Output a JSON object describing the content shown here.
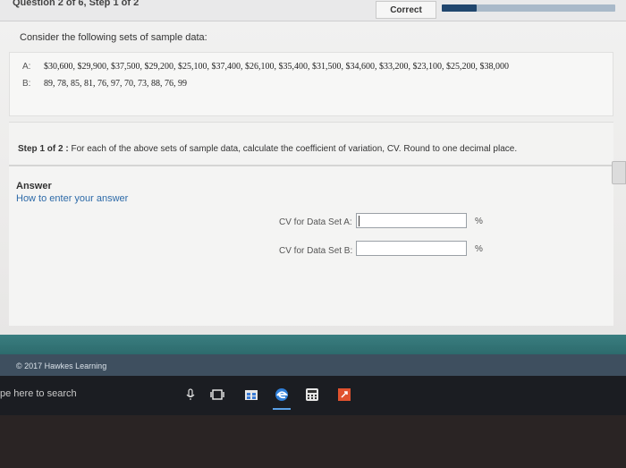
{
  "header": {
    "question_label": "Question 2 of 6, Step 1 of 2",
    "status_button": "Correct",
    "progress_fraction": 0.2
  },
  "content": {
    "intro": "Consider the following sets of sample data:",
    "set_a_label": "A:",
    "set_a_values": "$30,600, $29,900, $37,500, $29,200, $25,100, $37,400, $26,100, $35,400, $31,500, $34,600, $33,200, $23,100, $25,200, $38,000",
    "set_b_label": "B:",
    "set_b_values": "89, 78, 85, 81, 76, 97, 70, 73, 88, 76, 99",
    "step_label": "Step 1 of 2 :",
    "step_text": "For each of the above sets of sample data, calculate the coefficient of variation, CV. Round to one decimal place."
  },
  "answer": {
    "title": "Answer",
    "help_link": "How to enter your answer",
    "cv_a_label": "CV for Data Set A:",
    "cv_a_value": "",
    "cv_b_label": "CV for Data Set B:",
    "cv_b_value": "",
    "percent_symbol": "%"
  },
  "footer": {
    "copyright": "© 2017 Hawkes Learning"
  },
  "taskbar": {
    "search_text": "pe here to search",
    "icons": [
      "microphone-icon",
      "task-view-icon",
      "store-icon",
      "edge-icon",
      "calculator-icon",
      "app-icon"
    ]
  },
  "colors": {
    "accent_blue": "#20466e",
    "band_teal": "#2d6b6d",
    "link_blue": "#2d6aa8"
  }
}
